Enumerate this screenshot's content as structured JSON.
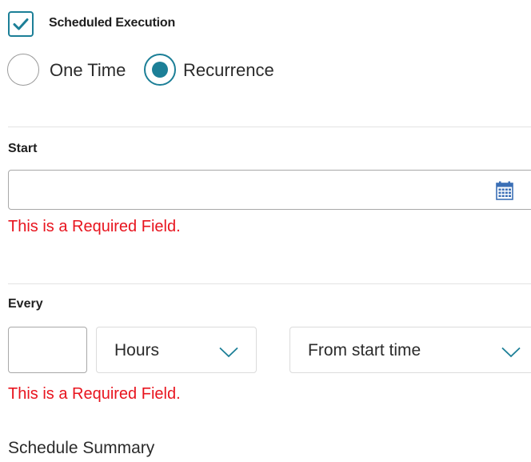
{
  "scheduled_execution": {
    "label": "Scheduled Execution",
    "checked": true
  },
  "schedule_type": {
    "options": [
      {
        "label": "One Time",
        "selected": false
      },
      {
        "label": "Recurrence",
        "selected": true
      }
    ]
  },
  "start": {
    "label": "Start",
    "value": "",
    "error": "This is a Required Field.",
    "icon": "calendar-icon"
  },
  "every": {
    "label": "Every",
    "value": "",
    "unit": "Hours",
    "mode": "From start time",
    "error": "This is a Required Field.",
    "icon": "chevron-down-icon"
  },
  "summary": {
    "label": "Schedule Summary"
  },
  "colors": {
    "accent": "#1c7f97",
    "error": "#e8141e",
    "calendar": "#3b6fb6"
  }
}
